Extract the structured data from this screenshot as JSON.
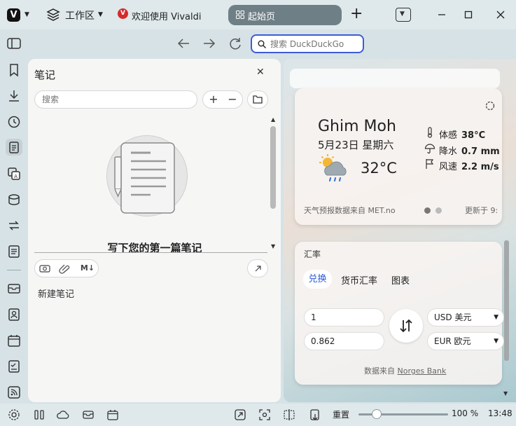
{
  "titlebar": {
    "workspace_label": "工作区",
    "tab_vivaldi_label": "欢迎使用 Vivaldi",
    "active_tab_label": "起始页",
    "newtab_symbol": "+",
    "vivaldi_logo_letter": "V"
  },
  "addressbar": {
    "search_placeholder": "搜索 DuckDuckGo"
  },
  "notes_panel": {
    "title": "笔记",
    "close_symbol": "✕",
    "search_placeholder": "搜索",
    "add_symbol": "+",
    "remove_symbol": "−",
    "empty_title": "写下您的第一篇笔记",
    "markdown_tool": "M↓",
    "new_note_label": "新建笔记"
  },
  "weather": {
    "city": "Ghim Moh",
    "date": "5月23日 星期六",
    "temperature": "32°C",
    "feels_like_label": "体感",
    "feels_like_value": "38°C",
    "precip_label": "降水",
    "precip_value": "0.7 mm",
    "wind_label": "风速",
    "wind_value": "2.2 m/s",
    "source": "天气预报数据来自 MET.no",
    "updated": "更新于 9:",
    "active_dot_color": "#777777",
    "inactive_dot_color": "#bbbbbb"
  },
  "currency": {
    "title": "汇率",
    "tabs": [
      "兑换",
      "货币汇率",
      "图表"
    ],
    "amount_from": "1",
    "amount_to": "0.862",
    "currency_from": "USD 美元",
    "currency_to": "EUR 欧元",
    "source_prefix": "数据来自",
    "source_link": "Norges Bank"
  },
  "statusbar": {
    "reset_label": "重置",
    "zoom": "100 %",
    "zoom_level": 0.2,
    "clock": "13:48"
  },
  "colors": {
    "accent": "#3f5bd8",
    "active_tab_bg": "#6f7f86"
  }
}
